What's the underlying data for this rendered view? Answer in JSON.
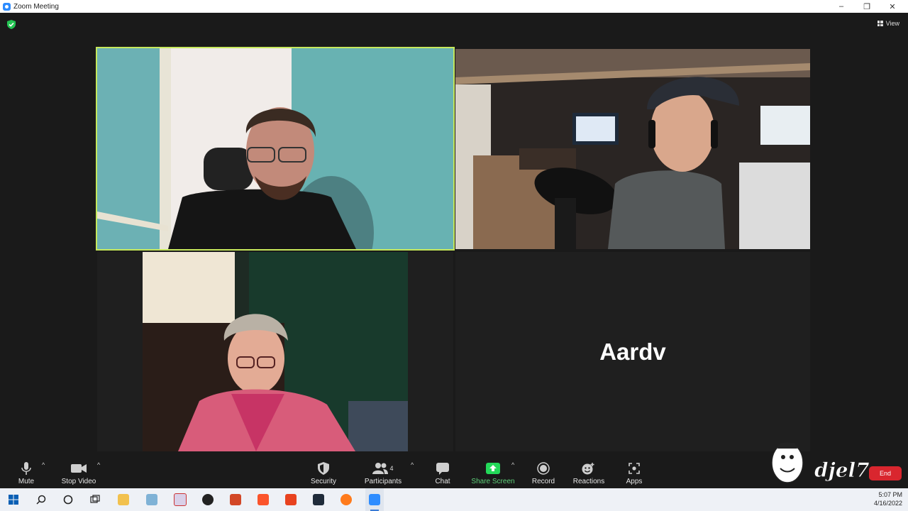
{
  "window": {
    "title": "Zoom Meeting",
    "controls": [
      "–",
      "❐",
      "✕"
    ]
  },
  "meeting": {
    "view_label": "View",
    "security_status": "shield-check-icon",
    "participant_tiles": [
      {
        "kind": "video",
        "active_speaker": true
      },
      {
        "kind": "video",
        "active_speaker": false
      },
      {
        "kind": "video",
        "active_speaker": false
      },
      {
        "kind": "name",
        "display_name": "Aardv"
      }
    ]
  },
  "toolbar": {
    "mute": {
      "label": "Mute",
      "icon": "microphone-icon"
    },
    "stop_video": {
      "label": "Stop Video",
      "icon": "video-camera-icon"
    },
    "security": {
      "label": "Security",
      "icon": "shield-icon"
    },
    "participants": {
      "label": "Participants",
      "count": "4",
      "icon": "people-icon"
    },
    "chat": {
      "label": "Chat",
      "icon": "chat-bubble-icon"
    },
    "share_screen": {
      "label": "Share Screen",
      "icon": "share-arrow-icon",
      "color": "#23d959"
    },
    "record": {
      "label": "Record",
      "icon": "record-icon"
    },
    "reactions": {
      "label": "Reactions",
      "icon": "smiley-icon"
    },
    "apps": {
      "label": "Apps",
      "icon": "apps-icon"
    },
    "end": {
      "label": "End",
      "color": "#d9262e"
    }
  },
  "watermark": {
    "text": "djel7"
  },
  "taskbar": {
    "time": "5:07 PM",
    "date": "4/16/2022",
    "apps": [
      "windows-start-icon",
      "search-icon",
      "cortana-icon",
      "task-view-icon",
      "file-explorer-icon",
      "app-icon",
      "app-icon",
      "obs-icon",
      "powerpoint-icon",
      "brave-icon",
      "office-icon",
      "app-icon",
      "firefox-icon",
      "zoom-icon"
    ]
  },
  "colors": {
    "active_speaker_border": "#c6e85c",
    "background": "#1a1a1a",
    "end_red": "#d9262e",
    "share_green": "#23d959"
  }
}
